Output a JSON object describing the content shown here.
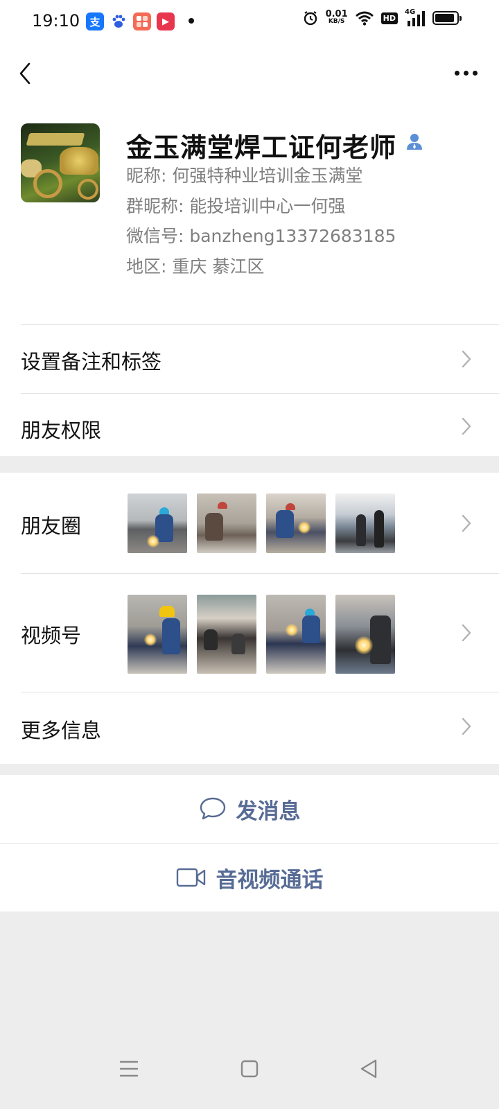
{
  "status_bar": {
    "time": "19:10",
    "net_speed_value": "0.01",
    "net_speed_unit": "KB/S",
    "hd_label": "HD",
    "network_label": "4G",
    "battery_level": 0.9,
    "app_icons": [
      {
        "name": "alipay-icon",
        "glyph": "支",
        "color": "#1677ff"
      },
      {
        "name": "baidu-icon",
        "glyph": "",
        "color": "#2f5fe0"
      },
      {
        "name": "app-store-icon",
        "glyph": "",
        "color": "#f56a56"
      },
      {
        "name": "video-app-icon",
        "glyph": "▶",
        "color": "#e8364e"
      }
    ]
  },
  "profile": {
    "display_name": "金玉满堂焊工证何老师",
    "nickname": "昵称:  何强特种业培训金玉满堂",
    "group_nickname": "群昵称:  能投培训中心一何强",
    "wechat_id": "微信号:  banzheng13372683185",
    "region": "地区:  重庆  綦江区"
  },
  "rows": {
    "remark_tags": "设置备注和标签",
    "friend_permissions": "朋友权限",
    "moments": "朋友圈",
    "channels": "视频号",
    "more_info": "更多信息"
  },
  "actions": {
    "send_message": "发消息",
    "av_call": "音视频通话"
  },
  "colors": {
    "accent_link": "#576b95",
    "secondary_text": "#7f7f7f",
    "page_background": "#ededed",
    "verified_icon": "#5b8fd6"
  }
}
